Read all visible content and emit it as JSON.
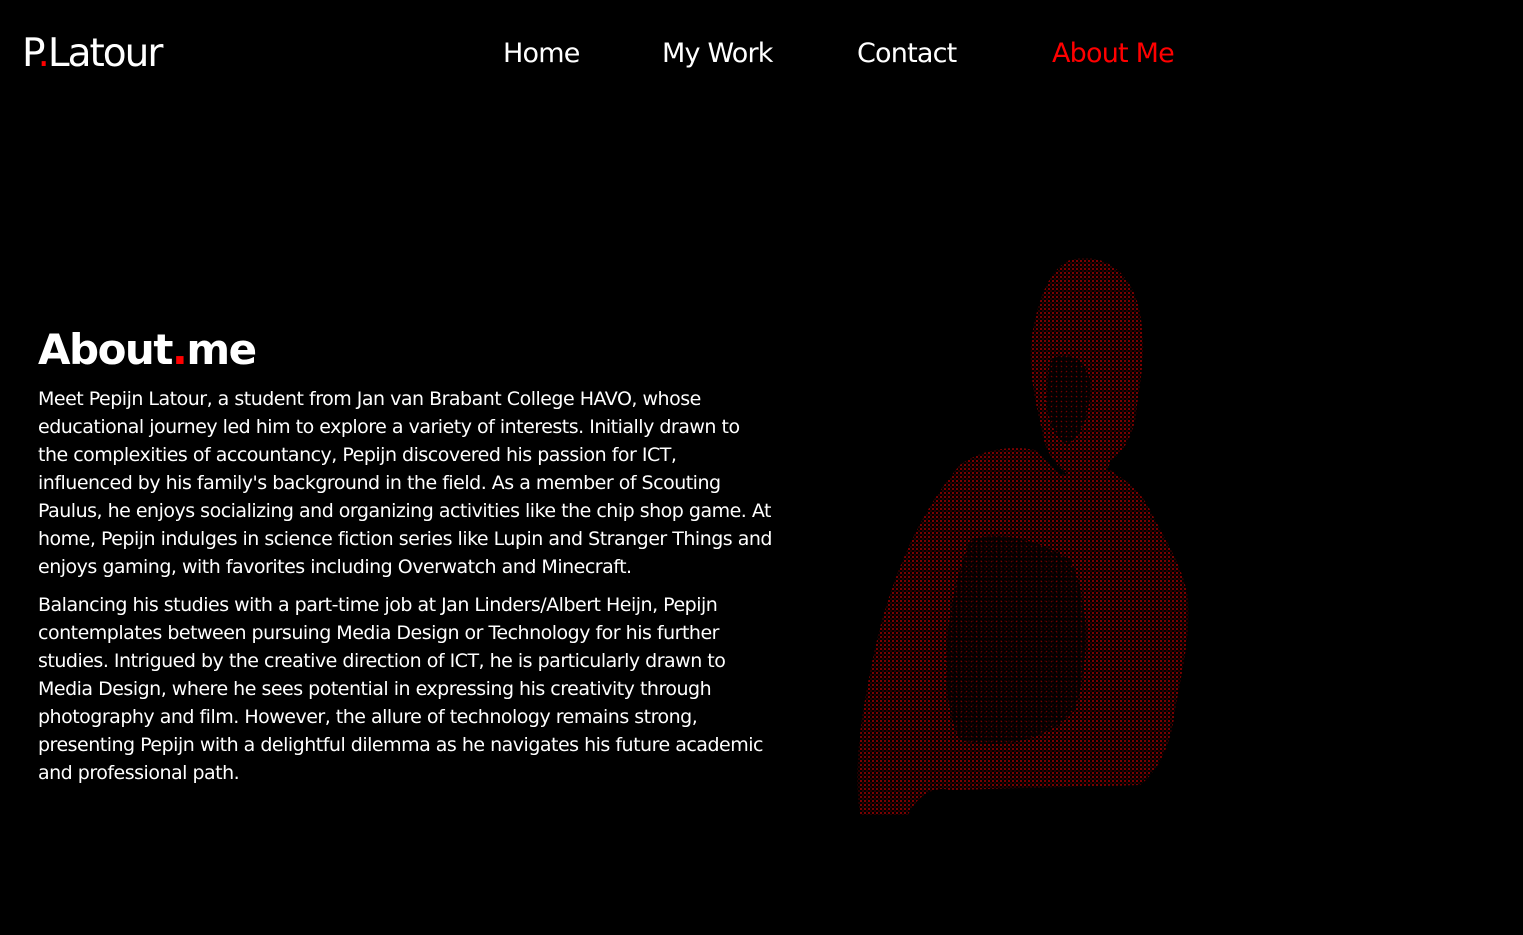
{
  "logo": {
    "initial": "P",
    "dot": ".",
    "name": "Latour"
  },
  "nav": {
    "items": [
      {
        "label": "Home",
        "active": false
      },
      {
        "label": "My Work",
        "active": false
      },
      {
        "label": "Contact",
        "active": false
      },
      {
        "label": "About Me",
        "active": true
      }
    ]
  },
  "about": {
    "title_first": "About",
    "title_dot": ".",
    "title_second": "me",
    "paragraphs": [
      "Meet Pepijn Latour, a student from Jan van Brabant College HAVO, whose educational journey led him to explore a variety of interests. Initially drawn to the complexities of accountancy, Pepijn discovered his passion for ICT, influenced by his family's background in the field. As a member of Scouting Paulus, he enjoys socializing and organizing activities like the chip shop game. At home, Pepijn indulges in science fiction series like Lupin and Stranger Things and enjoys gaming, with favorites including Overwatch and Minecraft.",
      "Balancing his studies with a part-time job at Jan Linders/Albert Heijn, Pepijn contemplates between pursuing Media Design or Technology for his further studies. Intrigued by the creative direction of ICT, he is particularly drawn to Media Design, where he sees potential in expressing his creativity through photography and film. However, the allure of technology remains strong, presenting Pepijn with a delightful dilemma as he navigates his future academic and professional path."
    ]
  },
  "colors": {
    "background": "#000000",
    "text": "#ffffff",
    "accent": "#ff0000"
  },
  "portrait": {
    "icon": "stippled-portrait-image"
  }
}
